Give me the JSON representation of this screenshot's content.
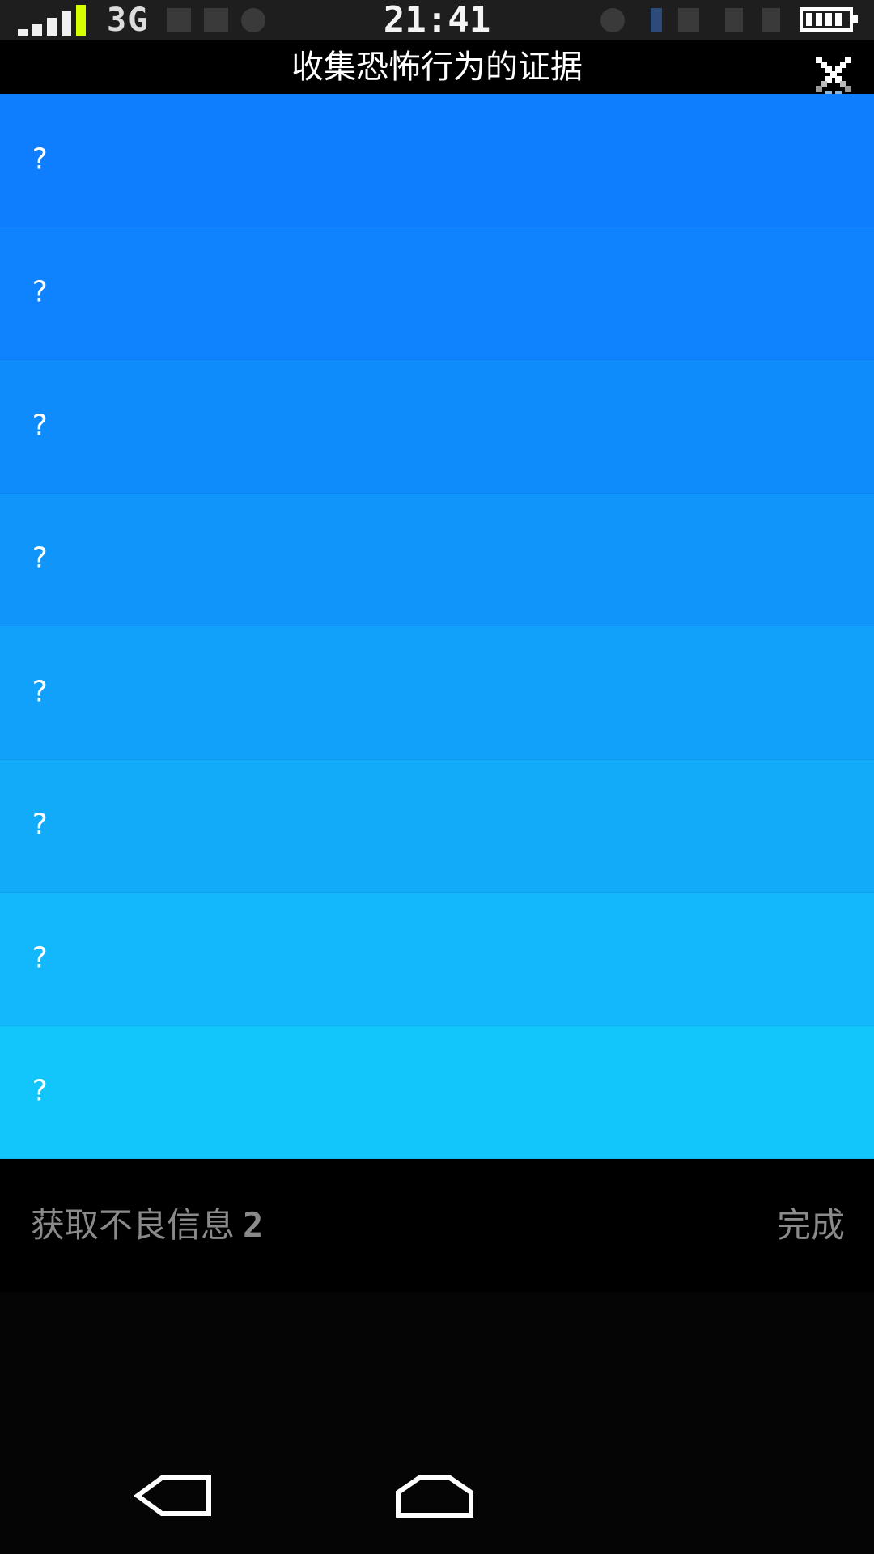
{
  "status_bar": {
    "network_type": "3G",
    "time": "21:41",
    "signal_icon": "signal-icon",
    "battery_icon": "battery-icon"
  },
  "title_bar": {
    "title": "收集恐怖行为的证据",
    "close_icon": "close-icon"
  },
  "evidence_list": {
    "items": [
      {
        "label": "?",
        "color": "#0e7eff"
      },
      {
        "label": "?",
        "color": "#0e83fd"
      },
      {
        "label": "?",
        "color": "#0f8cfc"
      },
      {
        "label": "?",
        "color": "#1095fb"
      },
      {
        "label": "?",
        "color": "#11a1fa"
      },
      {
        "label": "?",
        "color": "#12abfa"
      },
      {
        "label": "?",
        "color": "#12b8fb"
      },
      {
        "label": "?",
        "color": "#12c6fc"
      }
    ]
  },
  "info_bar": {
    "label": "获取不良信息",
    "count": "2",
    "done_label": "完成"
  },
  "nav_bar": {
    "back_icon": "back-icon",
    "home_icon": "home-icon"
  }
}
